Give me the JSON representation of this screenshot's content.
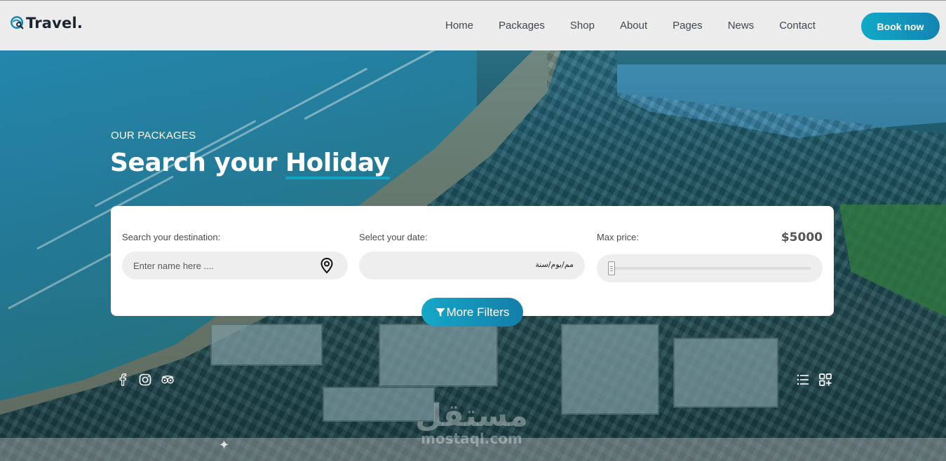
{
  "brand": {
    "name": "Travel.",
    "icon": "globe-search-icon"
  },
  "nav": {
    "items": [
      "Home",
      "Packages",
      "Shop",
      "About",
      "Pages",
      "News",
      "Contact"
    ],
    "cta": "Book now"
  },
  "hero": {
    "eyebrow": "OUR PACKAGES",
    "title_prefix": "Search your",
    "title_highlight": "Holiday"
  },
  "search": {
    "destination_label": "Search your destination:",
    "destination_placeholder": "Enter name here ....",
    "date_label": "Select your date:",
    "date_value": "مم/يوم/سنة",
    "price_label": "Max price:",
    "price_value": "$5000",
    "price_fraction": 0.0,
    "more_filters": "More Filters"
  },
  "social": [
    "facebook-icon",
    "instagram-icon",
    "tripadvisor-icon"
  ],
  "view_toggles": [
    "list-view-icon",
    "grid-view-icon"
  ],
  "watermark": {
    "arabic": "مستقل",
    "latin": "mostaql.com"
  },
  "colors": {
    "accent": "#12a4c4",
    "accent_dark": "#137eaa",
    "header_bg": "#ececec"
  }
}
